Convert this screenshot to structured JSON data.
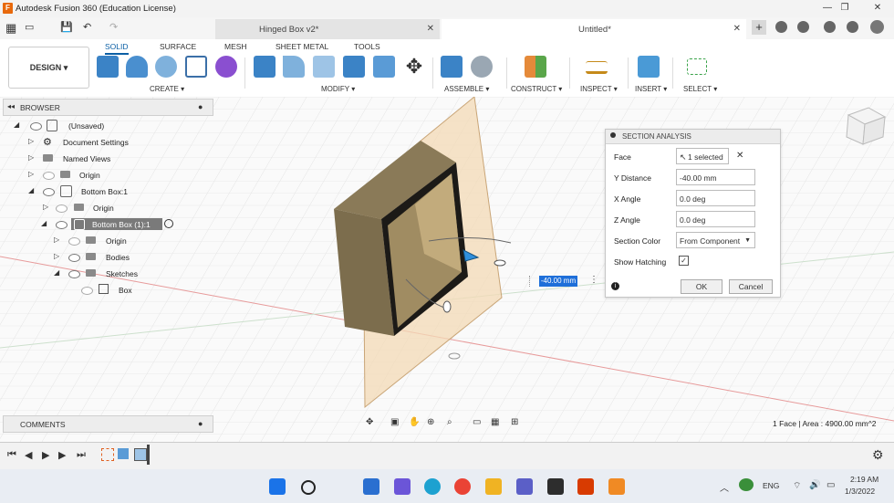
{
  "window": {
    "title": "Autodesk Fusion 360 (Education License)"
  },
  "tabs": [
    {
      "label": "Hinged Box v2*",
      "active": false
    },
    {
      "label": "Untitled*",
      "active": true
    }
  ],
  "toolbar": {
    "workspace": "DESIGN ▾",
    "category_tabs": [
      "SOLID",
      "SURFACE",
      "MESH",
      "SHEET METAL",
      "TOOLS"
    ],
    "groups": [
      "CREATE ▾",
      "MODIFY ▾",
      "ASSEMBLE ▾",
      "CONSTRUCT ▾",
      "INSPECT ▾",
      "INSERT ▾",
      "SELECT ▾"
    ]
  },
  "browser": {
    "title": "BROWSER",
    "items": [
      {
        "label": "(Unsaved)"
      },
      {
        "label": "Document Settings"
      },
      {
        "label": "Named Views"
      },
      {
        "label": "Origin"
      },
      {
        "label": "Bottom Box:1"
      },
      {
        "label": "Origin"
      },
      {
        "label": "Bottom Box (1):1"
      },
      {
        "label": "Origin"
      },
      {
        "label": "Bodies"
      },
      {
        "label": "Sketches"
      },
      {
        "label": "Box"
      }
    ]
  },
  "comments": {
    "label": "COMMENTS"
  },
  "section_analysis": {
    "title": "SECTION ANALYSIS",
    "face_label": "Face",
    "face_value": "1 selected",
    "y_distance_label": "Y Distance",
    "y_distance_value": "-40.00 mm",
    "x_angle_label": "X Angle",
    "x_angle_value": "0.0 deg",
    "z_angle_label": "Z Angle",
    "z_angle_value": "0.0 deg",
    "section_color_label": "Section Color",
    "section_color_value": "From Component",
    "show_hatching_label": "Show Hatching",
    "ok": "OK",
    "cancel": "Cancel"
  },
  "viewport": {
    "distance_tag": "-40.00 mm",
    "status": "1 Face | Area : 4900.00 mm^2"
  },
  "taskbar": {
    "language": "ENG",
    "time": "2:19 AM",
    "date": "1/3/2022"
  },
  "colors": {
    "accent": "#0b5fa5",
    "section_plane": "#f3d9b6",
    "body": "#8a7a58"
  }
}
